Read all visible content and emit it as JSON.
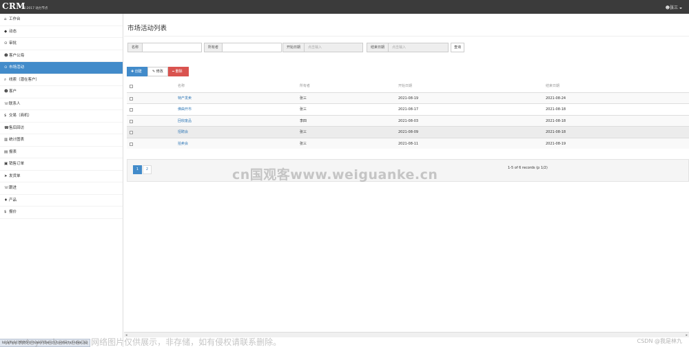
{
  "header": {
    "brand": "CRM",
    "brand_sub": "©2017 动力节点",
    "user": "张三"
  },
  "sidebar": {
    "items": [
      {
        "icon": "⌂",
        "label": "工作台",
        "active": false
      },
      {
        "icon": "◆",
        "label": "动态",
        "active": false
      },
      {
        "icon": "⊙",
        "label": "审批",
        "active": false
      },
      {
        "icon": "☻",
        "label": "客户公海",
        "active": false
      },
      {
        "icon": "⊙",
        "label": "市场活动",
        "active": true
      },
      {
        "icon": "⌕",
        "label": "线索（潜在客户）",
        "active": false
      },
      {
        "icon": "☻",
        "label": "客户",
        "active": false
      },
      {
        "icon": "☏",
        "label": "联系人",
        "active": false
      },
      {
        "icon": "$",
        "label": "交易（商机）",
        "active": false
      },
      {
        "icon": "☎",
        "label": "售后回访",
        "active": false
      },
      {
        "icon": "▥",
        "label": "统计图表",
        "active": false
      },
      {
        "icon": "▤",
        "label": "报表",
        "active": false
      },
      {
        "icon": "▣",
        "label": "销售订单",
        "active": false
      },
      {
        "icon": "➤",
        "label": "发货单",
        "active": false
      },
      {
        "icon": "☏",
        "label": "跟进",
        "active": false
      },
      {
        "icon": "♦",
        "label": "产品",
        "active": false
      },
      {
        "icon": "$",
        "label": "报价",
        "active": false
      }
    ]
  },
  "status_url": "localhost:8080/crm/workbench/contacts/index.jsp",
  "page_title": "市场活动列表",
  "filters": {
    "name_label": "名称",
    "name_value": "",
    "owner_label": "所有者",
    "owner_value": "",
    "start_label": "开始日期",
    "start_placeholder": "点击输入",
    "end_label": "结束日期",
    "end_placeholder": "点击输入",
    "query": "查询"
  },
  "toolbar": {
    "create": "创建",
    "edit": "修改",
    "delete": "删除"
  },
  "table": {
    "headers": {
      "name": "名称",
      "owner": "所有者",
      "start": "开始日期",
      "end": "结束日期"
    },
    "rows": [
      {
        "name": "特产发卖",
        "owner": "张三",
        "start": "2021-08-19",
        "end": "2021-08-24"
      },
      {
        "name": "佛曲开市",
        "owner": "张三",
        "start": "2021-08-17",
        "end": "2021-08-18"
      },
      {
        "name": "回收废品",
        "owner": "李四",
        "start": "2021-08-03",
        "end": "2021-08-18"
      },
      {
        "name": "招聘会",
        "owner": "张三",
        "start": "2021-08-09",
        "end": "2021-08-18"
      },
      {
        "name": "拍卖会",
        "owner": "张三",
        "start": "2021-08-11",
        "end": "2021-08-19"
      }
    ]
  },
  "pagination": {
    "pages": [
      "1",
      "2"
    ],
    "current": "1",
    "info": "1-5 of 6 records (p 1/2)"
  },
  "watermarks": {
    "middle": "cn国观客www.weiguanke.cn",
    "bottom": "www.toymoban.com 网络图片仅供展示，非存储，如有侵权请联系删除。",
    "csdn": "CSDN @我是林九"
  }
}
